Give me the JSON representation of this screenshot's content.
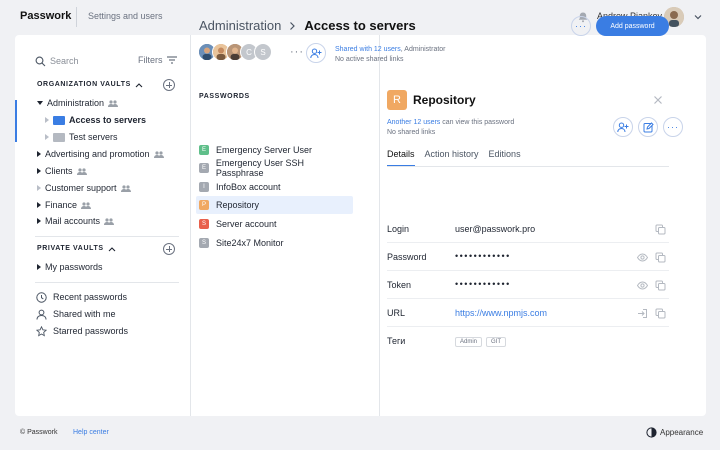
{
  "header": {
    "logo": "Passwork",
    "settings_link": "Settings and users",
    "user_name": "Andrew Piankov"
  },
  "sidebar": {
    "search_placeholder": "Search",
    "filters_label": "Filters",
    "org_vaults_title": "ORGANIZATION VAULTS",
    "org_items": [
      {
        "label": "Administration"
      },
      {
        "label": "Access to servers"
      },
      {
        "label": "Test servers"
      },
      {
        "label": "Advertising and promotion"
      },
      {
        "label": "Clients"
      },
      {
        "label": "Customer support"
      },
      {
        "label": "Finance"
      },
      {
        "label": "Mail accounts"
      }
    ],
    "private_vaults_title": "PRIVATE VAULTS",
    "private_items": [
      {
        "label": "My passwords"
      }
    ],
    "nav": [
      {
        "label": "Recent passwords",
        "icon": "clock-icon"
      },
      {
        "label": "Shared with me",
        "icon": "user-icon"
      },
      {
        "label": "Starred passwords",
        "icon": "star-icon"
      }
    ]
  },
  "main": {
    "breadcrumb_parent": "Administration",
    "breadcrumb_current": "Access to servers",
    "member_initials": [
      "C",
      "S"
    ],
    "shared_link": "Shared with 12 users",
    "shared_role": ", Administrator",
    "no_links": "No active shared links",
    "add_password_label": "Add password",
    "passwords_title": "PASSWORDS",
    "passwords": [
      {
        "label": "Emergency Server User",
        "letter": "E",
        "color": "#5fbf8a"
      },
      {
        "label": "Emergency User SSH Passphrase",
        "letter": "E",
        "color": "#a4a9b1"
      },
      {
        "label": "InfoBox account",
        "letter": "I",
        "color": "#a4a9b1"
      },
      {
        "label": "Repository",
        "letter": "P",
        "color": "#f0a862"
      },
      {
        "label": "Server account",
        "letter": "S",
        "color": "#e8604c"
      },
      {
        "label": "Site24x7 Monitor",
        "letter": "S",
        "color": "#a4a9b1"
      }
    ]
  },
  "detail": {
    "badge_letter": "R",
    "title": "Repository",
    "shared_link": "Another 12 users",
    "shared_rest": " can view this password",
    "no_links": "No shared links",
    "tabs": [
      "Details",
      "Action history",
      "Editions"
    ],
    "fields": [
      {
        "label": "Login",
        "value": "user@passwork.pro"
      },
      {
        "label": "Password",
        "value": "••••••••••••"
      },
      {
        "label": "Token",
        "value": "••••••••••••"
      },
      {
        "label": "URL",
        "value": "https://www.npmjs.com"
      },
      {
        "label": "Теги",
        "tags": [
          "Admin",
          "GIT"
        ]
      }
    ]
  },
  "footer": {
    "copyright": "© Passwork",
    "help": "Help center",
    "appearance": "Appearance"
  },
  "colors": {
    "accent": "#3a7de3",
    "selected_bg": "#e8f0fd"
  }
}
